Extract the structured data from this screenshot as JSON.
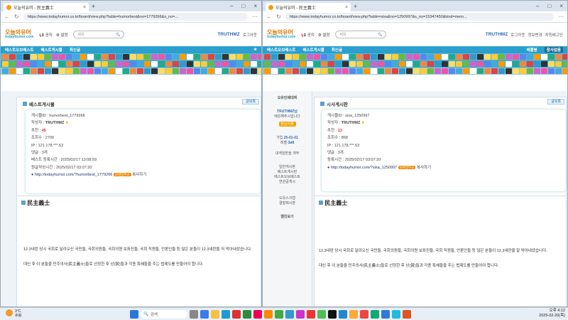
{
  "left": {
    "tab_title": "오늘의유머 - 民主義士",
    "url": "https://www.todayhumor.co.kr/board/view.php?table=humorbest&no=1779266&s_no=...",
    "header": {
      "logo_line1": "오늘의유머",
      "logo_line2": "todayhumor.com",
      "notice": "공지",
      "settings": "설정",
      "search_placeholder": "제목",
      "user": "TRUTHMZ",
      "logout": "로그아웃"
    },
    "menu": [
      "베스트오브베스트",
      "베스트게시물",
      "최신글"
    ],
    "board_title": "베스트게시물",
    "list_button": "글목록",
    "post": {
      "id": "게시물ID : humorbest_1779266",
      "author_label": "작성자 : ",
      "author": "TRUTHMZ",
      "recommend_label": "추천 : ",
      "recommend": "45",
      "views": "조회수 : 2706",
      "ip": "IP : 121.178.***.53",
      "comments": "댓글 : 3개",
      "best_time": "베스트 등록시간 : 2025/02/17 13:08:59",
      "orig_time": "원글작성시간 : 2025/02/17 03:07:20",
      "link": "http://todayhumor.com/?humorbest_1779266",
      "badge": "모바일주소",
      "copy": "복사하기"
    },
    "title": "民主義士",
    "body": [
      "12.3내란 당시 국회로 달려오신 국민들, 국회의원들, 국회의원 보좌진들, 국회 직원들, 언론인들 등 많은 분들이 12.3내란을 저 막아내셨습니다.",
      "대신 후 이 분들을 민주의사(民主義士)들로 선정한 후 상(賞)들과 각종 특혜들을 주는 법제도를 만들어야 합니다."
    ]
  },
  "right": {
    "tab_title": "오늘의유머 - 民主義士",
    "url": "https://www.todayhumor.co.kr/board/view.php?table=sisa&no=1250997&s_no=15347450&kind=mem...",
    "header": {
      "logo_line1": "오늘의유머",
      "logo_line2": "todayhumor.com",
      "notice": "공지",
      "settings": "설정",
      "search_placeholder": "제목",
      "user": "TRUTHMZ",
      "links": [
        "로그아웃",
        "정보변경",
        "차등배고인"
      ]
    },
    "menu": [
      "베스트오브베스트",
      "베스트게시물",
      "최신글"
    ],
    "menu_right": [
      "베플봉",
      "장사없음"
    ],
    "sidebar": {
      "title": "오유인베대찌",
      "user": "TRUTHMZ님",
      "sub": "에돈해주시압니다",
      "button": "환님어좋",
      "join_label": "가입",
      "join": "25-01-01",
      "point_label": "레벨",
      "point": "3ø8",
      "items": [
        "내게임받을 개부",
        "일반게시판",
        "베스트게시판",
        "베스트오브베스트",
        "연관글게시"
      ],
      "items2": [
        "오유스크랩",
        "결말제시판"
      ],
      "foot": "웹진보기"
    },
    "board_title": "시사게시판",
    "list_button": "글목록",
    "post": {
      "id": "게시물ID : sisa_1250997",
      "author_label": "작성자 : ",
      "author": "TRUTHMZ",
      "recommend_label": "추천 : ",
      "recommend": "13",
      "views": "조회수 : 868",
      "ip": "IP : 121.178.***.53",
      "comments": "댓글 : 3개",
      "reg_time": "등록시간 : 2025/02/17 03:07:20",
      "link": "http://todayhumor.com/?sisa_1250997",
      "badge": "모바일주소",
      "copy": "복사하기"
    },
    "title": "民主義士",
    "body": [
      "12.3내란 당시 국회로 달려오신 국민들, 국회의원들, 국회의원 보좌진들, 국회 직원들, 언론인들 등 많은 분들이 12.3내란을 잘 막아내셨습니다.",
      "대신 후 이 분들을 민주의사(民主義士)들로 선정한 후 상(賞)들과 각종 특혜들을 주는 법제도를 만들어야 합니다."
    ]
  },
  "taskbar": {
    "temp": "3°C",
    "weather": "흐림",
    "search": "검색",
    "time": "오후 4:12",
    "date": "2025-02-20(목)"
  },
  "colors": {
    "menu": "#2b9fcd",
    "accent": "#e27b00",
    "badge": "#f08a00"
  }
}
